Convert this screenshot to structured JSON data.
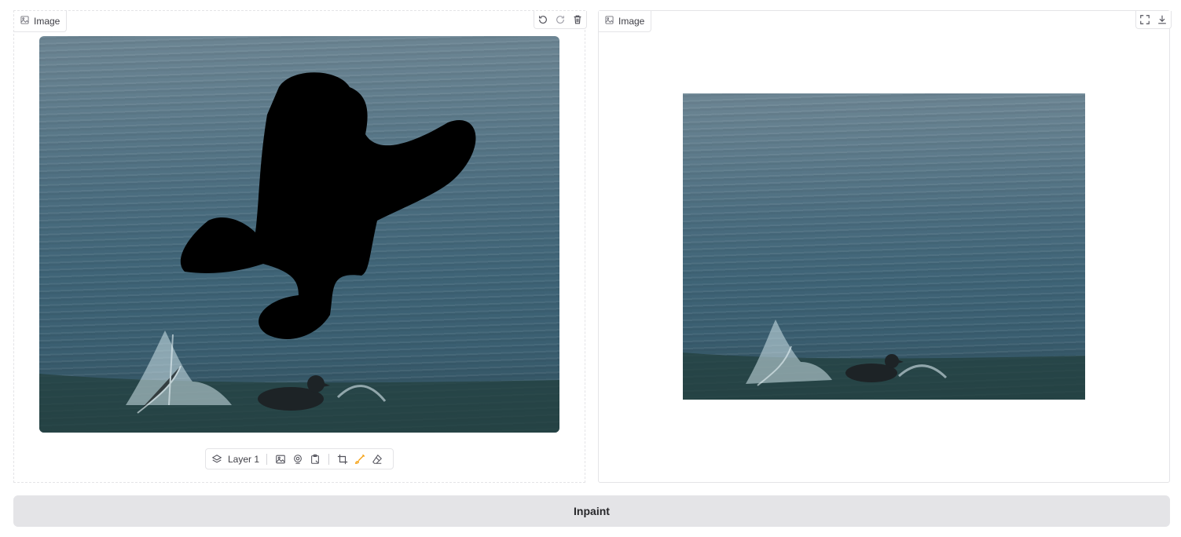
{
  "editor": {
    "label": "Image",
    "label_icon": "image-icon",
    "top_tools": [
      "undo-icon",
      "redo-icon",
      "trash-icon"
    ],
    "toolbar": {
      "layer_label": "Layer 1",
      "layer_icon": "layers-icon",
      "source_icons": [
        "upload-image-icon",
        "webcam-icon",
        "clipboard-icon"
      ],
      "tool_icons": [
        "crop-icon",
        "brush-icon",
        "eraser-icon"
      ]
    }
  },
  "output": {
    "label": "Image",
    "label_icon": "image-icon",
    "top_tools": [
      "fullscreen-icon",
      "download-icon"
    ]
  },
  "actions": {
    "inpaint_label": "Inpaint"
  },
  "colors": {
    "mask": "#000000",
    "button_bg": "#e4e4e7",
    "active_tool": "#f59e0b",
    "water": "#4b6d7f"
  }
}
